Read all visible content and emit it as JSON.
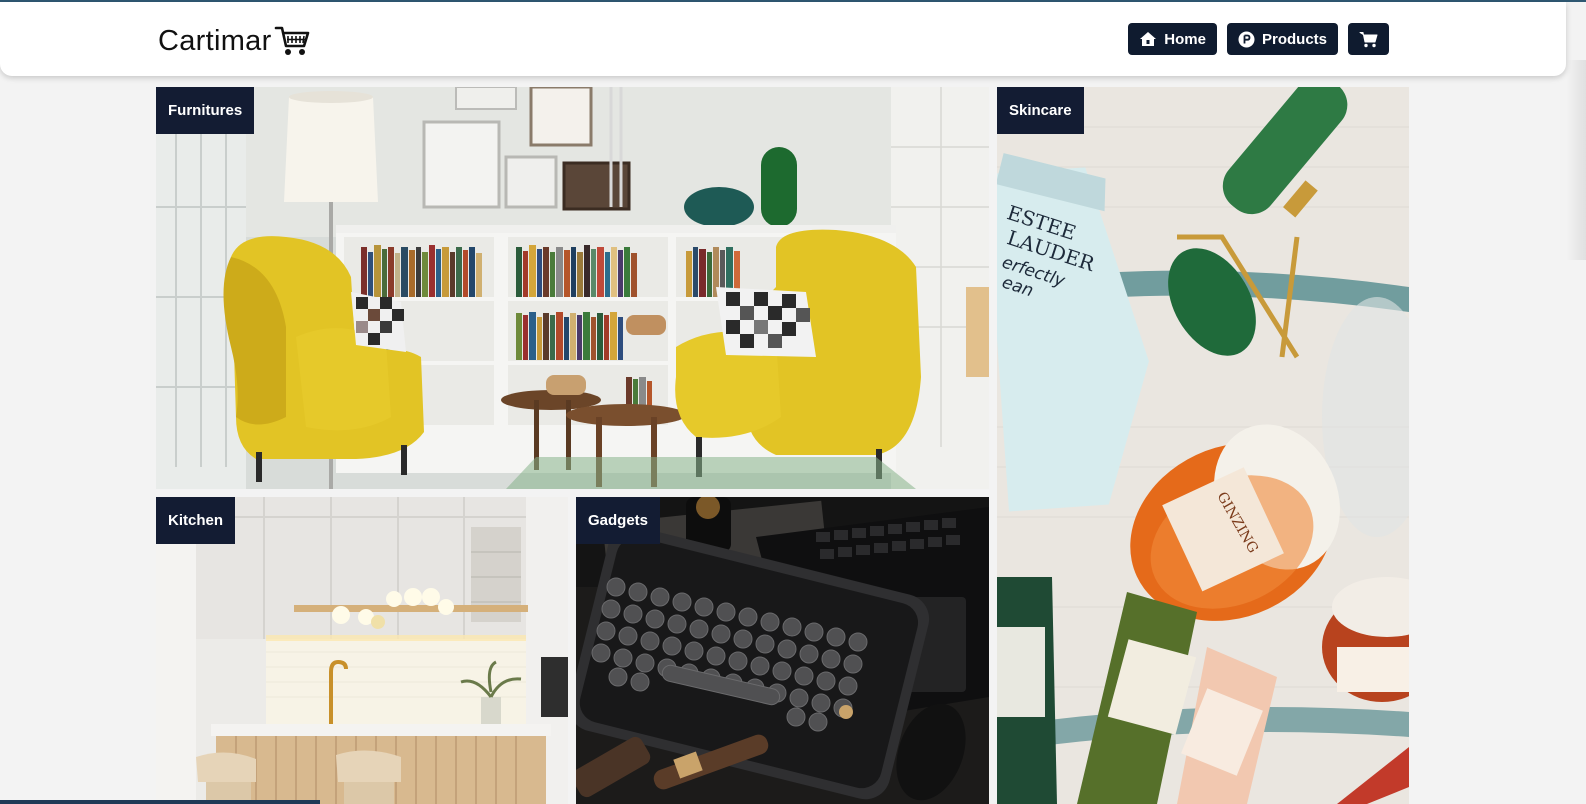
{
  "brand": {
    "name": "Cartimar",
    "logo_icon": "shopping-cart-icon"
  },
  "nav": {
    "home_label": "Home",
    "products_label": "Products",
    "home_icon": "home-icon",
    "products_icon": "product-badge-icon",
    "cart_icon": "cart-icon"
  },
  "categories": {
    "furnitures": "Furnitures",
    "skincare": "Skincare",
    "kitchen": "Kitchen",
    "gadgets": "Gadgets"
  },
  "colors": {
    "nav_button_bg": "#0f1b2f",
    "label_bg": "#131c33",
    "page_bg": "#f3f3f3"
  }
}
